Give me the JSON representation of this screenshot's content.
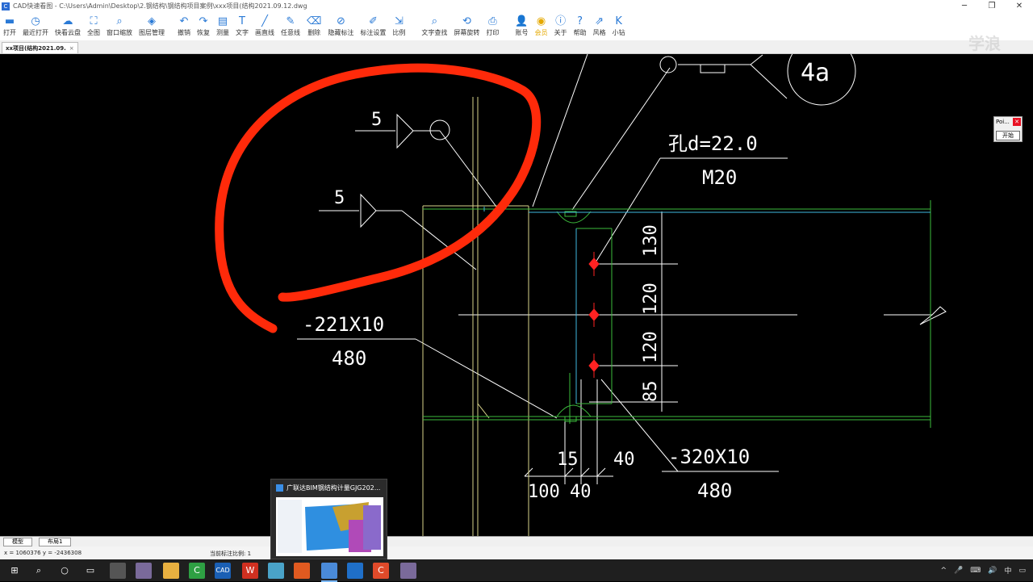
{
  "window": {
    "title": "CAD快速看图 - C:\\Users\\Admin\\Desktop\\2.钢结构\\钢结构项目案例\\xxx项目(结构2021.09.12.dwg",
    "controls": [
      "─",
      "❐",
      "✕"
    ]
  },
  "toolbar": {
    "items": [
      {
        "label": "打开",
        "icon": "folder-icon",
        "glyph": "▬"
      },
      {
        "label": "最近打开",
        "icon": "clock-icon",
        "glyph": "◷"
      },
      {
        "label": "快看云盘",
        "icon": "cloud-icon",
        "glyph": "☁"
      },
      {
        "label": "全图",
        "icon": "fullscreen-icon",
        "glyph": "⛶"
      },
      {
        "label": "窗口缩放",
        "icon": "window-zoom-icon",
        "glyph": "⌕"
      },
      {
        "label": "图层管理",
        "icon": "layers-icon",
        "glyph": "◈"
      },
      {
        "label": "撤销",
        "icon": "undo-icon",
        "glyph": "↶"
      },
      {
        "label": "恢复",
        "icon": "redo-icon",
        "glyph": "↷"
      },
      {
        "label": "测量",
        "icon": "ruler-icon",
        "glyph": "▤"
      },
      {
        "label": "文字",
        "icon": "text-icon",
        "glyph": "T"
      },
      {
        "label": "画直线",
        "icon": "line-icon",
        "glyph": "╱"
      },
      {
        "label": "任意线",
        "icon": "pen-icon",
        "glyph": "✎"
      },
      {
        "label": "删除",
        "icon": "eraser-icon",
        "glyph": "⌫"
      },
      {
        "label": "隐藏标注",
        "icon": "hide-icon",
        "glyph": "⊘"
      },
      {
        "label": "标注设置",
        "icon": "settings-icon",
        "glyph": "✐"
      },
      {
        "label": "比例",
        "icon": "scale-icon",
        "glyph": "⇲"
      },
      {
        "label": "文字查找",
        "icon": "search-icon",
        "glyph": "⌕"
      },
      {
        "label": "屏幕旋转",
        "icon": "rotate-icon",
        "glyph": "⟲"
      },
      {
        "label": "打印",
        "icon": "printer-icon",
        "glyph": "⎙"
      },
      {
        "label": "账号",
        "icon": "user-icon",
        "glyph": "👤"
      },
      {
        "label": "会员",
        "icon": "vip-icon",
        "glyph": "◉"
      },
      {
        "label": "关于",
        "icon": "info-icon",
        "glyph": "ⓘ"
      },
      {
        "label": "帮助",
        "icon": "help-icon",
        "glyph": "?"
      },
      {
        "label": "风格",
        "icon": "style-icon",
        "glyph": "⇗"
      },
      {
        "label": "小钻",
        "icon": "k-icon",
        "glyph": "K"
      }
    ]
  },
  "tabs": {
    "doc_tab": "xx项目(结构2021.09.",
    "close": "×"
  },
  "watermark": "学浪",
  "drawing": {
    "weld1": "5",
    "weld2": "5",
    "plate1_a": "-221X10",
    "plate1_b": "480",
    "hole": "孔d=22.0",
    "bolt": "M20",
    "dim1": "130",
    "dim2": "120",
    "dim3": "120",
    "dim4": "85",
    "dim5": "15",
    "dim6": "40",
    "dim7": "40",
    "dim8": "100",
    "plate2_a": "-320X10",
    "plate2_b": "480",
    "detail": "4a"
  },
  "poi_dialog": {
    "title": "Poi...",
    "button": "开始"
  },
  "layout_tabs": [
    "模型",
    "布局1"
  ],
  "status": {
    "coords": "x = 1060376  y = -2436308",
    "scale": "当前标注比例: 1"
  },
  "preview": {
    "title": "广联达BIM钢结构计量GJG202..."
  },
  "tray": {
    "ime": "中",
    "icons": [
      "^",
      "🎤",
      "⌨",
      "🔊"
    ]
  },
  "colors": {
    "accent": "#2a7ad6",
    "annotation_red": "#ff2a0a",
    "beam_blue": "#40b8e0",
    "cad_green": "#3dbd3d",
    "cad_yellow": "#d8d48a"
  }
}
